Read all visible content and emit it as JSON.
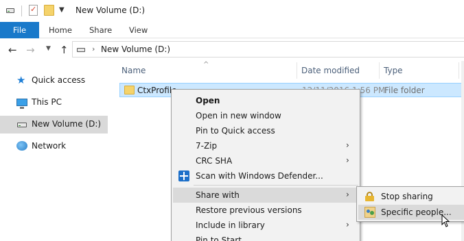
{
  "window": {
    "title": "New Volume (D:)"
  },
  "ribbon": {
    "tabs": [
      {
        "label": "File"
      },
      {
        "label": "Home"
      },
      {
        "label": "Share"
      },
      {
        "label": "View"
      }
    ]
  },
  "address": {
    "path": "New Volume (D:)"
  },
  "nav": {
    "items": [
      {
        "label": "Quick access",
        "icon": "quick-access-star-icon"
      },
      {
        "label": "This PC",
        "icon": "computer-icon"
      },
      {
        "label": "New Volume (D:)",
        "icon": "drive-icon",
        "selected": true
      },
      {
        "label": "Network",
        "icon": "network-icon"
      }
    ]
  },
  "columns": {
    "name": "Name",
    "date": "Date modified",
    "type": "Type"
  },
  "rows": [
    {
      "name": "CtxProfile",
      "date": "12/11/2016 1:56 PM",
      "type": "File folder"
    }
  ],
  "context_menu": {
    "items": [
      {
        "label": "Open",
        "bold": true
      },
      {
        "label": "Open in new window"
      },
      {
        "label": "Pin to Quick access"
      },
      {
        "label": "7-Zip",
        "submenu": true
      },
      {
        "label": "CRC SHA",
        "submenu": true
      },
      {
        "label": "Scan with Windows Defender...",
        "icon": "windows-defender-icon"
      },
      {
        "label": "Share with",
        "submenu": true,
        "highlighted": true
      },
      {
        "label": "Restore previous versions"
      },
      {
        "label": "Include in library",
        "submenu": true
      },
      {
        "label": "Pin to Start"
      }
    ]
  },
  "share_submenu": {
    "items": [
      {
        "label": "Stop sharing",
        "icon": "lock-icon"
      },
      {
        "label": "Specific people...",
        "icon": "people-icon",
        "highlighted": true
      }
    ]
  },
  "colors": {
    "file_tab": "#1979ca",
    "selection": "#cce8ff",
    "menu_bg": "#f2f2f2",
    "menu_highlight": "#dadada"
  }
}
